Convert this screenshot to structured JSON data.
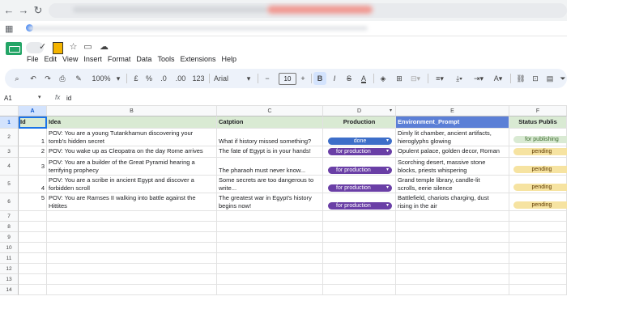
{
  "browser": {
    "back_icon": "arrow-left-icon",
    "forward_icon": "arrow-right-icon",
    "reload_icon": "reload-icon"
  },
  "menu": [
    "File",
    "Edit",
    "View",
    "Insert",
    "Format",
    "Data",
    "Tools",
    "Extensions",
    "Help"
  ],
  "toolbar": {
    "zoom": "100%",
    "currency": "£",
    "percent": "%",
    "decrease_decimal": ".0",
    "increase_decimal": ".00",
    "number_format": "123",
    "font": "Arial",
    "font_size": "10",
    "bold": "B",
    "italic": "I",
    "text_color": "A"
  },
  "formula_bar": {
    "name_box": "A1",
    "fx": "fx",
    "value": "id"
  },
  "columns": [
    "A",
    "B",
    "C",
    "D",
    "E",
    "F"
  ],
  "rows": [
    "1",
    "2",
    "3",
    "4",
    "5",
    "6",
    "7",
    "8",
    "9",
    "10",
    "11",
    "12",
    "13",
    "14"
  ],
  "header": {
    "id": "Id",
    "idea": "Idea",
    "caption": "Catption",
    "production": "Production",
    "env": "Environment_Prompt",
    "status": "Status Publis"
  },
  "data_rows": [
    {
      "id": "1",
      "idea_1": "POV: You are a young Tutankhamun discovering your",
      "idea_2": "tomb's hidden secret",
      "caption_1": "",
      "caption_2": "What if history missed something?",
      "production": "done",
      "env_1": "Dimly lit chamber, ancient artifacts,",
      "env_2": "hieroglyphs glowing",
      "status": "for publishing"
    },
    {
      "id": "2",
      "idea_1": "POV: You wake up as Cleopatra on the day Rome arrives",
      "idea_2": "",
      "caption_1": "The fate of Egypt is in your hands!",
      "caption_2": "",
      "production": "for production",
      "env_1": "Opulent palace, golden decor, Roman",
      "env_2": "",
      "status": "pending"
    },
    {
      "id": "3",
      "idea_1": "POV: You are a builder of the Great Pyramid hearing a",
      "idea_2": "terrifying prophecy",
      "caption_1": "",
      "caption_2": "The pharaoh must never know...",
      "production": "for production",
      "env_1": "Scorching desert, massive stone",
      "env_2": "blocks, priests whispering",
      "status": "pending"
    },
    {
      "id": "4",
      "idea_1": "POV: You are a scribe in ancient Egypt and discover a",
      "idea_2": "forbidden scroll",
      "caption_1": "Some secrets are too dangerous to",
      "caption_2": "write...",
      "production": "for production",
      "env_1": "Grand temple library, candle-lit",
      "env_2": "scrolls, eerie silence",
      "status": "pending"
    },
    {
      "id": "5",
      "idea_1": "POV: You are Ramses II walking into battle against the",
      "idea_2": "Hittites",
      "caption_1": "The greatest war in Egypt's history",
      "caption_2": "begins now!",
      "production": "for production",
      "env_1": "Battlefield, chariots charging, dust",
      "env_2": "rising in the air",
      "status": "pending"
    }
  ],
  "colors": {
    "header_green": "#d9ead3",
    "header_blue": "#5b7fd6",
    "done_chip": "#3d6ec9",
    "production_chip": "#6a3fa6",
    "publishing_pill": "#d9ead3",
    "pending_pill": "#f6e3a1"
  }
}
